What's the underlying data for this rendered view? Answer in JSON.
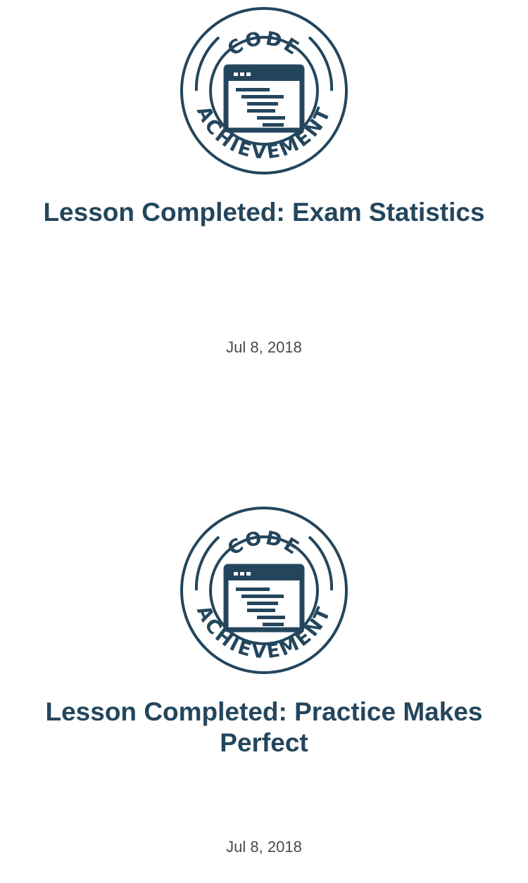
{
  "achievements": [
    {
      "badge": {
        "top_text": "CODE",
        "bottom_text": "ACHIEVEMENT",
        "icon": "code-window-icon",
        "color": "#24465d"
      },
      "title": "Lesson Completed: Exam Statistics",
      "date": "Jul 8, 2018"
    },
    {
      "badge": {
        "top_text": "CODE",
        "bottom_text": "ACHIEVEMENT",
        "icon": "code-window-icon",
        "color": "#24465d"
      },
      "title": "Lesson Completed: Practice Makes Perfect",
      "date": "Jul 8, 2018"
    }
  ]
}
